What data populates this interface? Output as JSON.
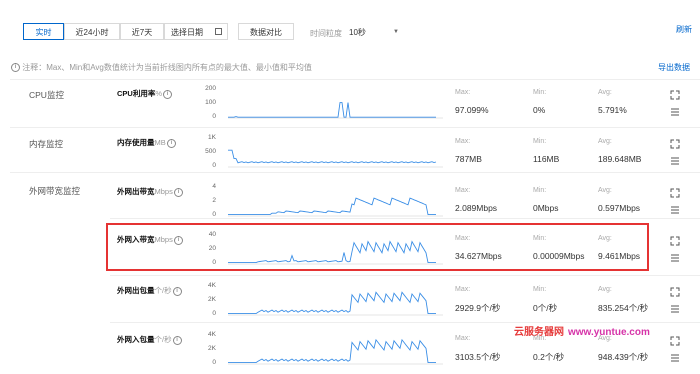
{
  "toolbar": {
    "buttons": [
      "实时",
      "近24小时",
      "近7天",
      "选择日期"
    ],
    "compare_button": "数据对比",
    "granularity_label": "时间粒度",
    "granularity_value": "10秒",
    "refresh": "刷新"
  },
  "note": {
    "text": "注释：Max、Min和Avg数值统计为当前折线图内所有点的最大值、最小值和平均值",
    "export": "导出数据"
  },
  "sections": [
    {
      "label": "CPU监控"
    },
    {
      "label": "内存监控"
    },
    {
      "label": "外网带宽监控"
    }
  ],
  "metrics": [
    {
      "name": "CPU利用率",
      "unit": "%",
      "yticks": [
        "200",
        "100",
        "0"
      ],
      "max_label": "Max:",
      "max": "97.099%",
      "min_label": "Min:",
      "min": "0%",
      "avg_label": "Avg:",
      "avg": "5.791%"
    },
    {
      "name": "内存使用量",
      "unit": "MB",
      "yticks": [
        "1K",
        "500",
        "0"
      ],
      "max_label": "Max:",
      "max": "787MB",
      "min_label": "Min:",
      "min": "116MB",
      "avg_label": "Avg:",
      "avg": "189.648MB"
    },
    {
      "name": "外网出带宽",
      "unit": "Mbps",
      "yticks": [
        "4",
        "2",
        "0"
      ],
      "max_label": "Max:",
      "max": "2.089Mbps",
      "min_label": "Min:",
      "min": "0Mbps",
      "avg_label": "Avg:",
      "avg": "0.597Mbps"
    },
    {
      "name": "外网入带宽",
      "unit": "Mbps",
      "yticks": [
        "40",
        "20",
        "0"
      ],
      "max_label": "Max:",
      "max": "34.627Mbps",
      "min_label": "Min:",
      "min": "0.00009Mbps",
      "avg_label": "Avg:",
      "avg": "9.461Mbps"
    },
    {
      "name": "外网出包量",
      "unit": "个/秒",
      "yticks": [
        "4K",
        "2K",
        "0"
      ],
      "max_label": "Max:",
      "max": "2929.9个/秒",
      "min_label": "Min:",
      "min": "0个/秒",
      "avg_label": "Avg:",
      "avg": "835.254个/秒"
    },
    {
      "name": "外网入包量",
      "unit": "个/秒",
      "yticks": [
        "4K",
        "2K",
        "0"
      ],
      "max_label": "Max:",
      "max": "3103.5个/秒",
      "min_label": "Min:",
      "min": "0.2个/秒",
      "avg_label": "Avg:",
      "avg": "948.439个/秒"
    }
  ],
  "watermark": {
    "part1": "云服务器网",
    "part2": "www.yuntue.com"
  },
  "colors": {
    "accent": "#0066cc",
    "line": "#3a8ee6",
    "highlight": "#e53333",
    "watermark1": "#e63c3c",
    "watermark2": "#d633a8"
  }
}
